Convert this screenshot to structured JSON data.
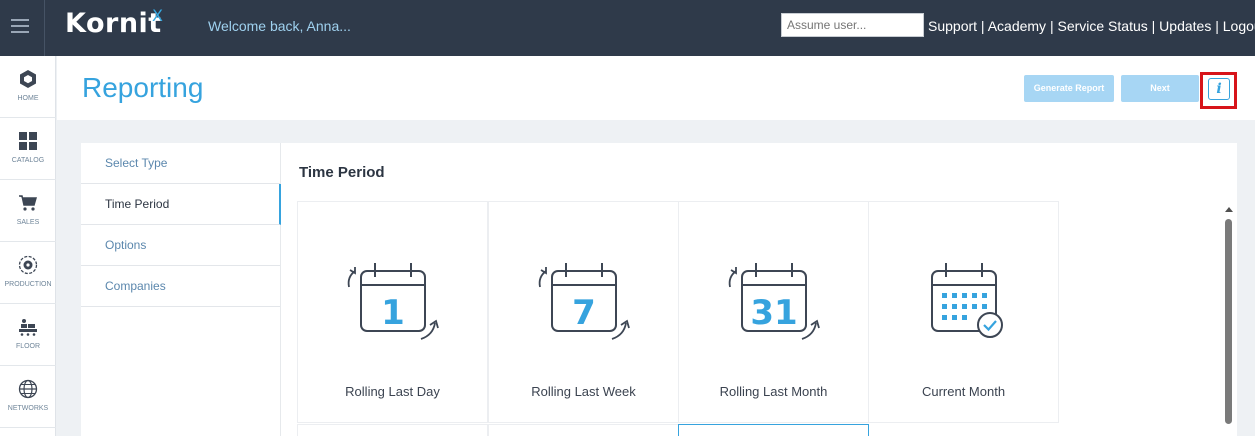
{
  "topbar": {
    "brand": "Kornit",
    "brand_suffix": "X",
    "welcome": "Welcome back, Anna...",
    "assume_placeholder": "Assume user...",
    "links": [
      "Support",
      "Academy",
      "Service Status",
      "Updates",
      "Logout"
    ],
    "separator": " | ",
    "icons": {
      "menu": "hamburger-menu-icon"
    }
  },
  "leftnav": {
    "items": [
      {
        "label": "HOME",
        "icon": "home-hexagon-icon"
      },
      {
        "label": "CATALOG",
        "icon": "grid-icon"
      },
      {
        "label": "SALES",
        "icon": "cart-icon"
      },
      {
        "label": "PRODUCTION",
        "icon": "gear-icon"
      },
      {
        "label": "FLOOR",
        "icon": "floor-machines-icon"
      },
      {
        "label": "NETWORKS",
        "icon": "globe-icon"
      }
    ]
  },
  "header": {
    "title": "Reporting",
    "generate_label": "Generate Report",
    "next_label": "Next",
    "info_label": "i"
  },
  "steps": [
    {
      "label": "Select Type",
      "active": false
    },
    {
      "label": "Time Period",
      "active": true
    },
    {
      "label": "Options",
      "active": false
    },
    {
      "label": "Companies",
      "active": false
    }
  ],
  "section_title": "Time Period",
  "tiles": [
    {
      "label": "Rolling Last Day",
      "number": "1",
      "icon": "calendar-rolling-day-icon"
    },
    {
      "label": "Rolling Last Week",
      "number": "7",
      "icon": "calendar-rolling-week-icon"
    },
    {
      "label": "Rolling Last Month",
      "number": "31",
      "icon": "calendar-rolling-month-icon"
    },
    {
      "label": "Current Month",
      "number": "",
      "icon": "calendar-current-month-icon"
    }
  ],
  "colors": {
    "topbar": "#2f3a4a",
    "accent": "#36a3de",
    "button_disabled": "#a7d6f4",
    "highlight": "#d7141a",
    "icon_dark": "#3d4654"
  }
}
